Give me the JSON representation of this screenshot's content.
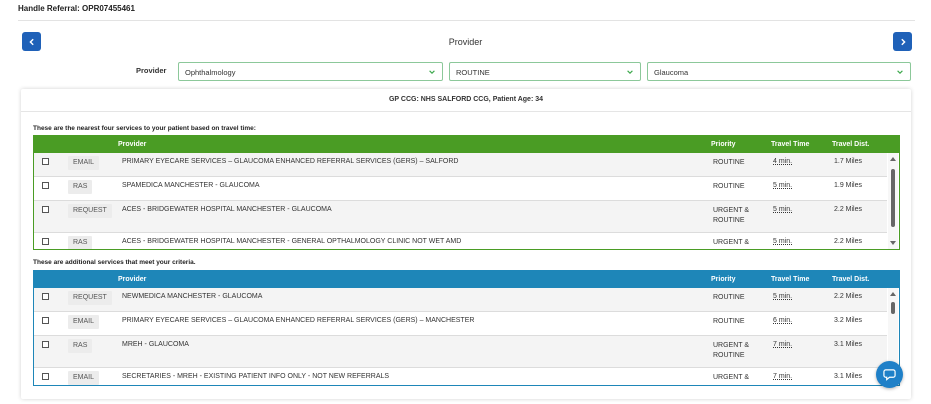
{
  "header": {
    "title": "Handle Referral: OPR07455461"
  },
  "nav": {
    "prev_icon": "chevron-left-icon",
    "next_icon": "chevron-right-icon"
  },
  "section_heading": "Provider",
  "filters": {
    "label": "Provider",
    "specialty": "Ophthalmology",
    "priority": "ROUTINE",
    "condition": "Glaucoma"
  },
  "patient_info": "GP CCG: NHS SALFORD CCG, Patient Age: 34",
  "nearest": {
    "caption": "These are the nearest four services to your patient based on travel time:",
    "columns": {
      "provider": "Provider",
      "priority": "Priority",
      "travel_time": "Travel Time",
      "travel_dist": "Travel Dist."
    },
    "rows": [
      {
        "type": "EMAIL",
        "provider": "PRIMARY EYECARE SERVICES – GLAUCOMA ENHANCED REFERRAL SERVICES (GERS) – SALFORD",
        "priority": "ROUTINE",
        "time": "4 min.",
        "dist": "1.7 Miles"
      },
      {
        "type": "RAS",
        "provider": "SPAMEDICA MANCHESTER - GLAUCOMA",
        "priority": "ROUTINE",
        "time": "5 min.",
        "dist": "1.9 Miles"
      },
      {
        "type": "REQUEST",
        "provider": "ACES - BRIDGEWATER HOSPITAL MANCHESTER - GLAUCOMA",
        "priority": "URGENT & ROUTINE",
        "time": "5 min.",
        "dist": "2.2 Miles"
      },
      {
        "type": "RAS",
        "provider": "ACES - BRIDGEWATER HOSPITAL MANCHESTER - GENERAL OPTHALMOLOGY CLINIC NOT WET AMD",
        "priority": "URGENT &",
        "time": "5 min.",
        "dist": "2.2 Miles"
      }
    ]
  },
  "additional": {
    "caption": "These are additional services that meet your criteria.",
    "columns": {
      "provider": "Provider",
      "priority": "Priority",
      "travel_time": "Travel Time",
      "travel_dist": "Travel Dist."
    },
    "rows": [
      {
        "type": "REQUEST",
        "provider": "NEWMEDICA MANCHESTER - GLAUCOMA",
        "priority": "ROUTINE",
        "time": "5 min.",
        "dist": "2.2 Miles"
      },
      {
        "type": "EMAIL",
        "provider": "PRIMARY EYECARE SERVICES – GLAUCOMA ENHANCED REFERRAL SERVICES (GERS) – MANCHESTER",
        "priority": "ROUTINE",
        "time": "6 min.",
        "dist": "3.2 Miles"
      },
      {
        "type": "RAS",
        "provider": "MREH - GLAUCOMA",
        "priority": "URGENT & ROUTINE",
        "time": "7 min.",
        "dist": "3.1 Miles"
      },
      {
        "type": "EMAIL",
        "provider": "SECRETARIES - MREH - EXISTING PATIENT INFO ONLY - NOT NEW REFERRALS",
        "priority": "URGENT &",
        "time": "7 min.",
        "dist": "3.1 Miles"
      }
    ]
  },
  "colors": {
    "nav_blue": "#1f61b8",
    "nearest_green": "#4a9c24",
    "additional_blue": "#1e86b8",
    "help_blue": "#1f80c8"
  },
  "help": {
    "icon": "chat-bubble-icon"
  }
}
